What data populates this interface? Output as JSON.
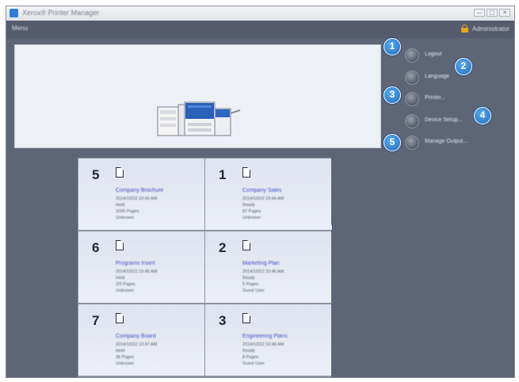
{
  "window": {
    "title": "Xerox® Printer Manager",
    "controls": [
      "—",
      "□",
      "✕"
    ]
  },
  "menubar": {
    "menu_label": "Menu",
    "user_label": "Administrator"
  },
  "colors": {
    "accent": "#2f7fd1",
    "callout": "#2270c2",
    "lock": "#e3a41e",
    "link": "#3d52c8"
  },
  "side_buttons": [
    {
      "label": "Logout",
      "callout": "1"
    },
    {
      "label": "Language",
      "callout": "2"
    },
    {
      "label": "Printer...",
      "callout": "3"
    },
    {
      "label": "Device Setup...",
      "callout": "4"
    },
    {
      "label": "Manage Output...",
      "callout": "5"
    }
  ],
  "grid_callout": "6",
  "jobs": [
    {
      "number": "5",
      "name": "Company Brochure",
      "date": "2014/10/22 10:42 AM",
      "status": "Held",
      "sheets": "1000 Pages",
      "owner": "Unknown"
    },
    {
      "number": "1",
      "name": "Company Sales",
      "date": "2014/10/22 10:44 AM",
      "status": "Ready",
      "sheets": "87 Pages",
      "owner": "Unknown"
    },
    {
      "number": "6",
      "name": "Programs Insert",
      "date": "2014/10/22 10:45 AM",
      "status": "Held",
      "sheets": "2/5 Pages",
      "owner": "Unknown"
    },
    {
      "number": "2",
      "name": "Marketing Plan",
      "date": "2014/10/22 10:46 AM",
      "status": "Ready",
      "sheets": "5 Pages",
      "owner": "Guest User"
    },
    {
      "number": "7",
      "name": "Company Board",
      "date": "2014/10/22 10:47 AM",
      "status": "Held",
      "sheets": "38 Pages",
      "owner": "Unknown"
    },
    {
      "number": "3",
      "name": "Engineering Plans",
      "date": "2014/10/22 10:48 AM",
      "status": "Ready",
      "sheets": "8 Pages",
      "owner": "Guest User"
    }
  ]
}
